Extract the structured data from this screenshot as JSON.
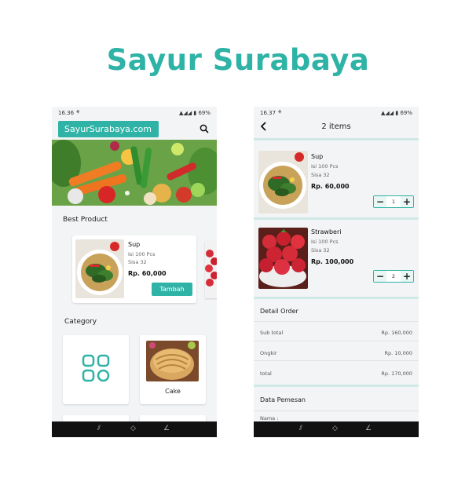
{
  "brand_title": "Sayur Surabaya",
  "colors": {
    "accent": "#2eb3a6",
    "background": "#f3f4f6",
    "navbar": "#111111"
  },
  "screen_home": {
    "status": {
      "time": "16.36",
      "battery": "69%"
    },
    "header": {
      "site_name": "SayurSurabaya.com",
      "search_icon": "search-icon"
    },
    "best_product": {
      "title": "Best Product",
      "product": {
        "name": "Sup",
        "isi": "Isi 100 Pcs",
        "sisa": "Sisa 32",
        "price": "Rp. 60,000",
        "button": "Tambah"
      }
    },
    "category": {
      "title": "Category",
      "items": [
        {
          "label": "",
          "icon": "grid-icon"
        },
        {
          "label": "Cake"
        }
      ]
    }
  },
  "screen_cart": {
    "status": {
      "time": "16.37",
      "battery": "69%"
    },
    "header": {
      "title": "2 items"
    },
    "items": [
      {
        "name": "Sup",
        "isi": "Isi 100 Pcs",
        "sisa": "Sisa 32",
        "price": "Rp. 60,000",
        "qty": "1"
      },
      {
        "name": "Strawberi",
        "isi": "Isi 100 Pcs",
        "sisa": "Sisa 32",
        "price": "Rp. 100,000",
        "qty": "2"
      }
    ],
    "detail_order": {
      "title": "Detail Order",
      "rows": [
        {
          "label": "Sub total",
          "value": "Rp. 160,000"
        },
        {
          "label": "Ongkir",
          "value": "Rp. 10,000"
        },
        {
          "label": "total",
          "value": "Rp. 170,000"
        }
      ]
    },
    "data_pemesan": {
      "title": "Data Pemesan",
      "field_label": "Nama :"
    }
  }
}
